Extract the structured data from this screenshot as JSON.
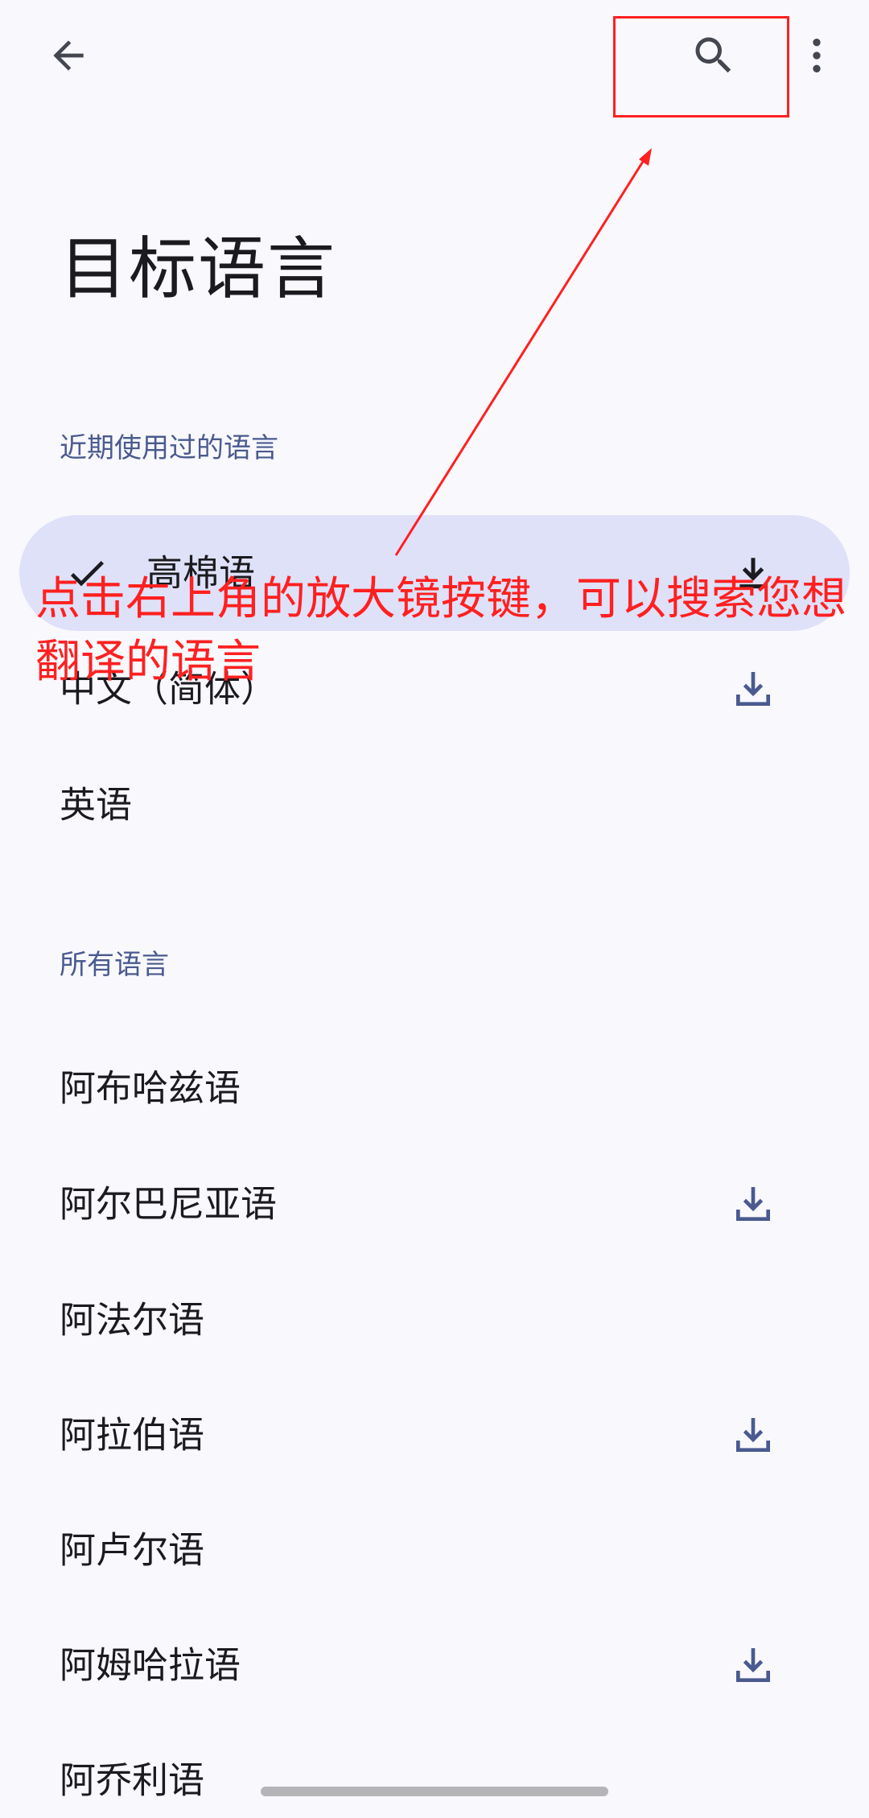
{
  "toolbar": {
    "back_icon": "arrow-left-icon",
    "search_icon": "search-icon",
    "more_icon": "more-vertical-icon"
  },
  "page": {
    "title": "目标语言"
  },
  "recent": {
    "header": "近期使用过的语言",
    "items": [
      {
        "label": "高棉语",
        "selected": true,
        "downloaded": true
      },
      {
        "label": "中文（简体）",
        "selected": false,
        "downloadable": true
      },
      {
        "label": "英语",
        "selected": false,
        "downloadable": false
      }
    ]
  },
  "all": {
    "header": "所有语言",
    "items": [
      {
        "label": "阿布哈兹语",
        "downloadable": false
      },
      {
        "label": "阿尔巴尼亚语",
        "downloadable": true
      },
      {
        "label": "阿法尔语",
        "downloadable": false
      },
      {
        "label": "阿拉伯语",
        "downloadable": true
      },
      {
        "label": "阿卢尔语",
        "downloadable": false
      },
      {
        "label": "阿姆哈拉语",
        "downloadable": true
      },
      {
        "label": "阿乔利语",
        "downloadable": false
      }
    ]
  },
  "annotation": {
    "text": "点击右上角的放大镜按键，可以搜索您想翻译的语言",
    "color": "#ff2020"
  },
  "colors": {
    "background": "#f8f8fd",
    "selected_bg": "#dfe1f9",
    "accent": "#4a5a8f",
    "text": "#1b1b1f"
  }
}
